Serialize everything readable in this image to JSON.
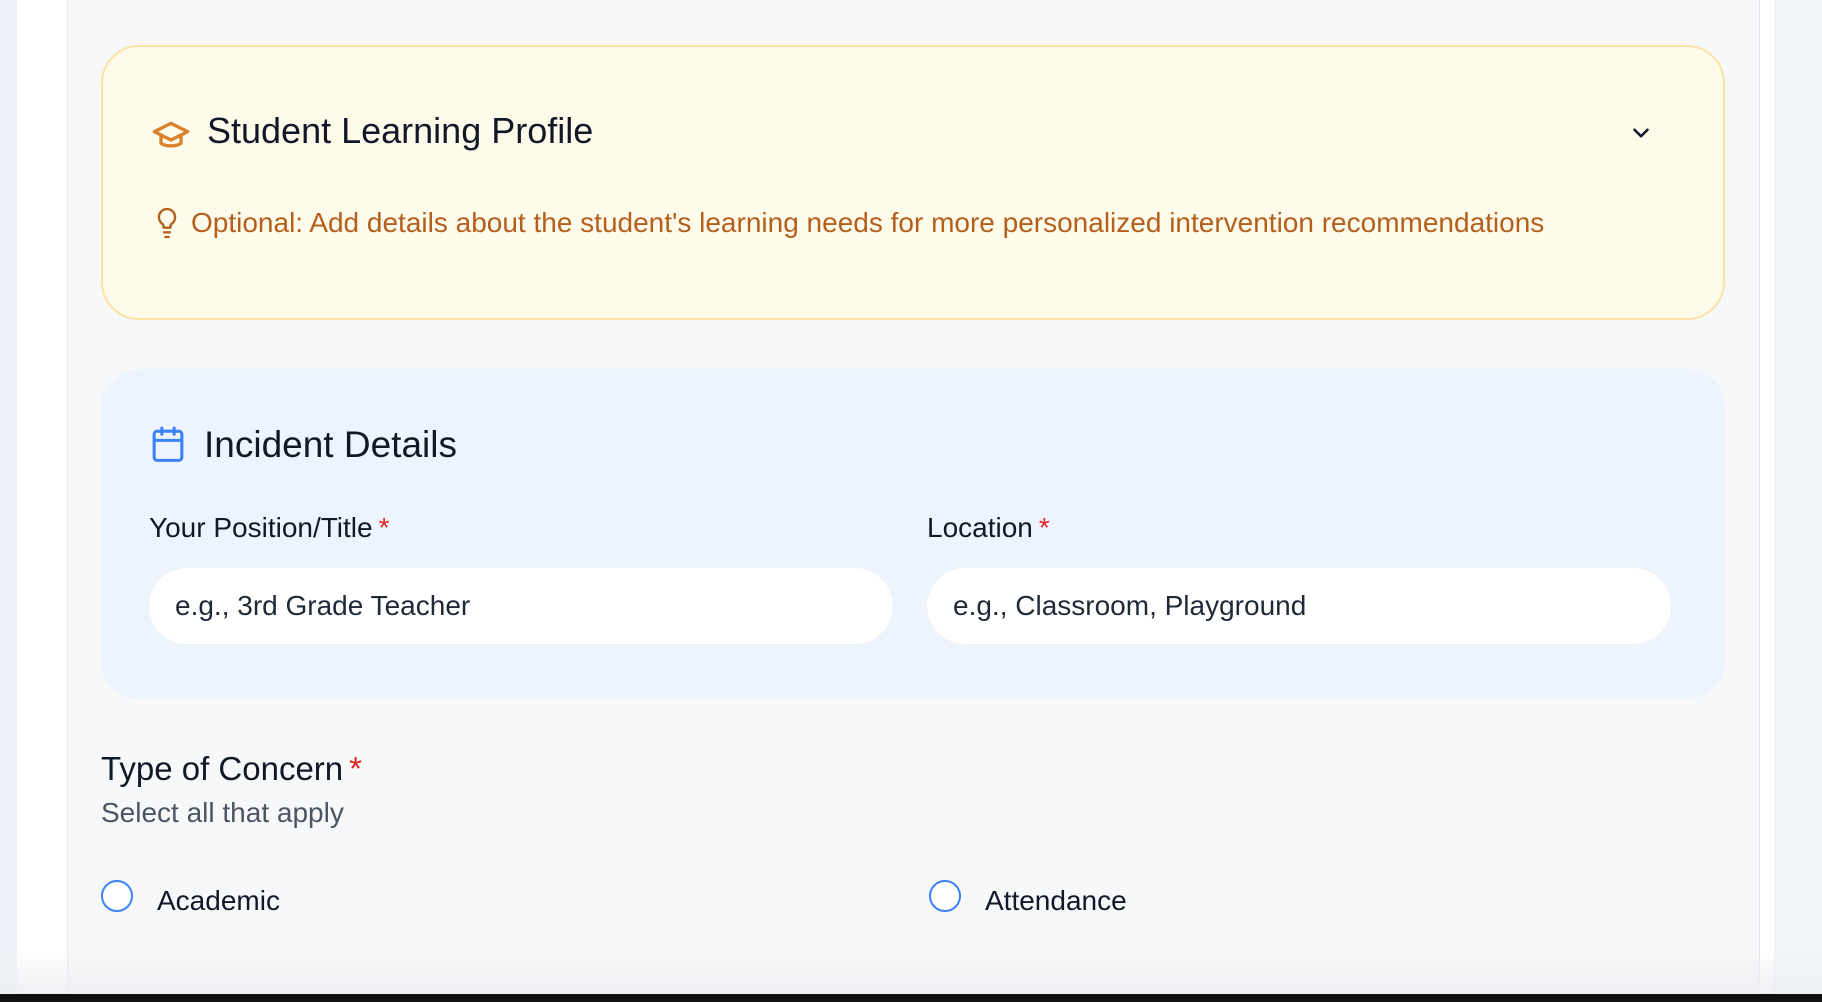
{
  "learning_profile": {
    "title": "Student Learning Profile",
    "hint": "Optional: Add details about the student's learning needs for more personalized intervention recommendations",
    "icon": "graduation-cap-icon",
    "hint_icon": "lightbulb-icon",
    "accent_color": "#d9822b",
    "hint_color": "#b45f1c",
    "background": "#fffbeb"
  },
  "incident": {
    "title": "Incident Details",
    "icon": "calendar-icon",
    "accent_color": "#3b82f6",
    "background": "#eef4fe",
    "position_label": "Your Position/Title",
    "position_placeholder": "e.g., 3rd Grade Teacher",
    "location_label": "Location",
    "location_placeholder": "e.g., Classroom, Playground",
    "required_marker": "*"
  },
  "concern": {
    "title": "Type of Concern",
    "required_marker": "*",
    "subtitle": "Select all that apply",
    "options": [
      {
        "label": "Academic",
        "checked": false
      },
      {
        "label": "Attendance",
        "checked": false
      }
    ]
  }
}
